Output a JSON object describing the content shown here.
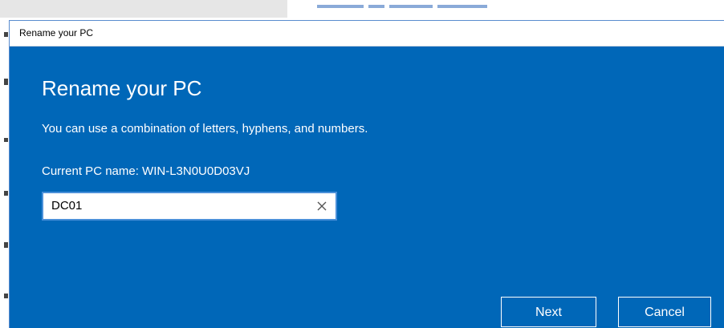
{
  "dialog": {
    "window_title": "Rename your PC",
    "heading": "Rename your PC",
    "description": "You can use a combination of letters, hyphens, and numbers.",
    "current_name_label": "Current PC name: WIN-L3N0U0D03VJ",
    "name_input": {
      "value": "DC01",
      "clear_icon": "close-icon"
    },
    "buttons": {
      "next_label": "Next",
      "cancel_label": "Cancel"
    }
  },
  "colors": {
    "dialog_background": "#0067b8",
    "text": "#ffffff",
    "input_border": "#4a90d9"
  }
}
